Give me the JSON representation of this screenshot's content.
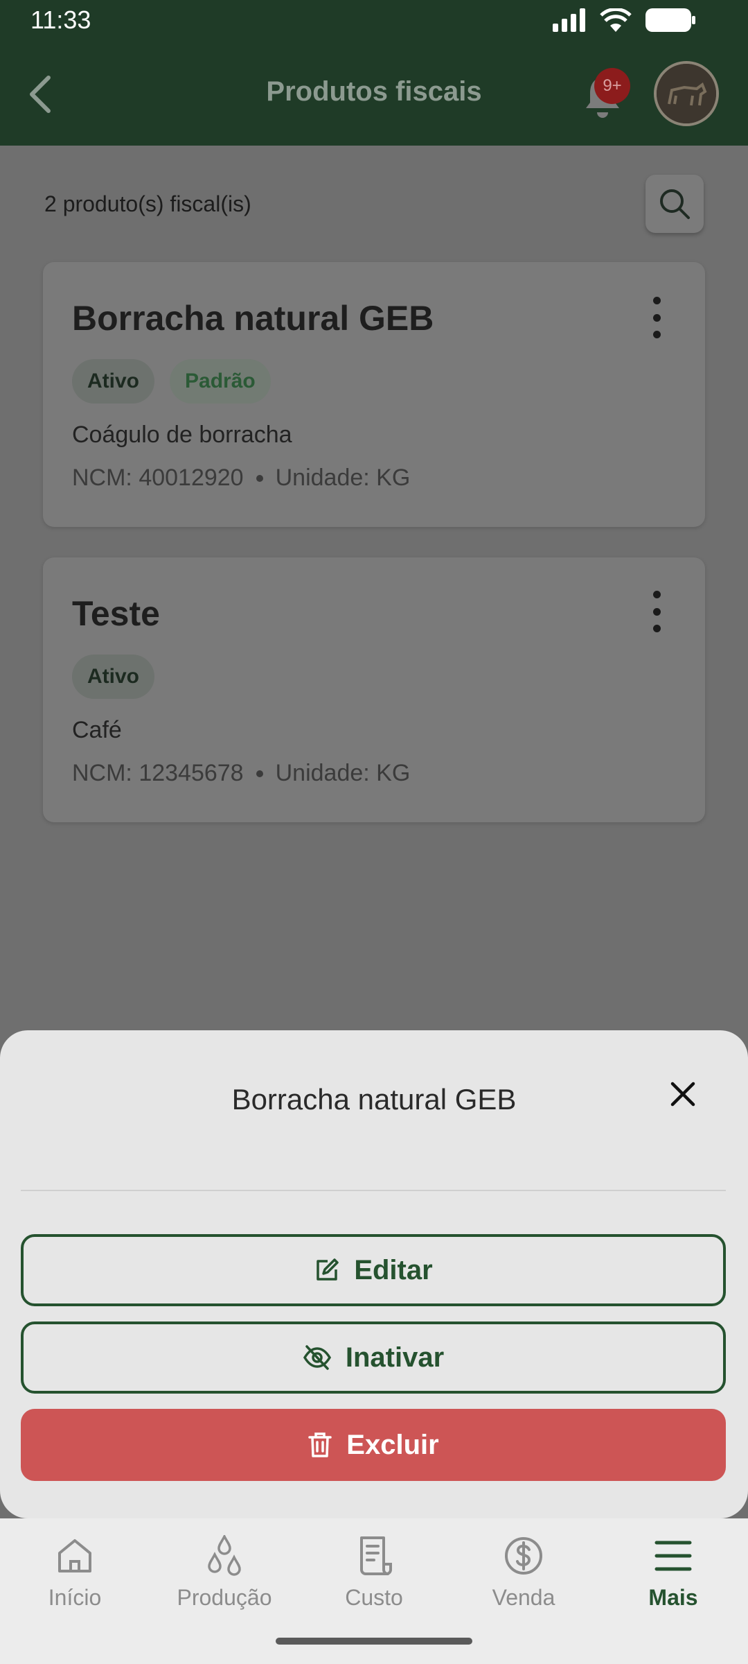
{
  "status_bar": {
    "time": "11:33"
  },
  "header": {
    "title": "Produtos fiscais",
    "notification_badge": "9+"
  },
  "list": {
    "count_text": "2 produto(s) fiscal(is)",
    "products": [
      {
        "name": "Borracha natural GEB",
        "badges": [
          "Ativo",
          "Padrão"
        ],
        "description": "Coágulo de borracha",
        "ncm": "NCM: 40012920",
        "unit": "Unidade: KG"
      },
      {
        "name": "Teste",
        "badges": [
          "Ativo"
        ],
        "description": "Café",
        "ncm": "NCM: 12345678",
        "unit": "Unidade: KG"
      }
    ]
  },
  "sheet": {
    "title": "Borracha natural GEB",
    "edit_label": "Editar",
    "deactivate_label": "Inativar",
    "delete_label": "Excluir"
  },
  "nav": {
    "items": [
      {
        "label": "Início",
        "icon": "home-icon"
      },
      {
        "label": "Produção",
        "icon": "drops-icon"
      },
      {
        "label": "Custo",
        "icon": "receipt-icon"
      },
      {
        "label": "Venda",
        "icon": "dollar-circle-icon"
      },
      {
        "label": "Mais",
        "icon": "menu-icon"
      }
    ],
    "active": "Mais"
  },
  "colors": {
    "primary_green": "#25522f",
    "danger": "#cd5555",
    "header_bg": "#1f3b27"
  }
}
